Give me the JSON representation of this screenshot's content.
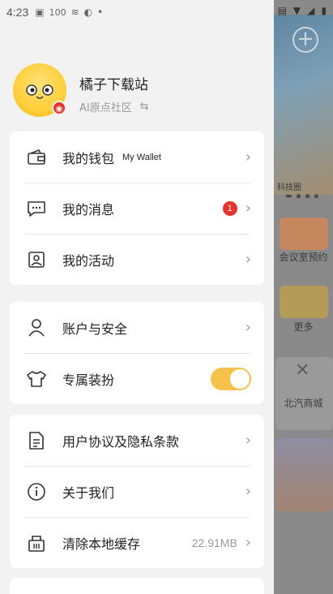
{
  "status_bar": {
    "time": "4:23",
    "battery_text": "100"
  },
  "background_app": {
    "caption": "科技圈",
    "tiles": [
      {
        "label": "会议室预约"
      },
      {
        "label": "更多"
      },
      {
        "label": "北汽商城"
      }
    ]
  },
  "profile": {
    "name": "橘子下载站",
    "community": "AI原点社区"
  },
  "groups": [
    {
      "items": [
        {
          "id": "wallet",
          "label": "我的钱包",
          "sub": "My Wallet",
          "icon": "wallet-icon"
        },
        {
          "id": "messages",
          "label": "我的消息",
          "badge": "1",
          "icon": "message-icon"
        },
        {
          "id": "activity",
          "label": "我的活动",
          "icon": "activity-icon"
        }
      ]
    },
    {
      "items": [
        {
          "id": "account",
          "label": "账户与安全",
          "icon": "user-icon"
        },
        {
          "id": "outfit",
          "label": "专属装扮",
          "icon": "tshirt-icon",
          "toggle": true
        }
      ]
    },
    {
      "items": [
        {
          "id": "agreement",
          "label": "用户协议及隐私条款",
          "icon": "document-icon"
        },
        {
          "id": "about",
          "label": "关于我们",
          "icon": "info-icon"
        },
        {
          "id": "cache",
          "label": "清除本地缓存",
          "value": "22.91MB",
          "icon": "trash-icon"
        }
      ]
    }
  ],
  "colors": {
    "accent": "#f6c24a",
    "badge": "#e8332b",
    "drawer_bg": "#f2f2f2"
  }
}
